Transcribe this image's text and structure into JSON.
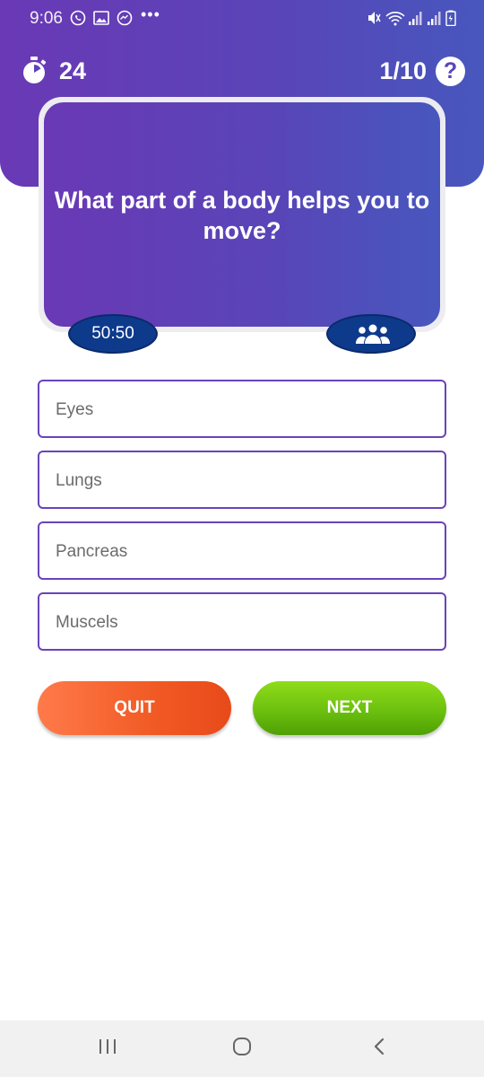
{
  "status_bar": {
    "time": "9:06",
    "icons": [
      "whatsapp-icon",
      "gallery-icon",
      "messenger-icon",
      "more-dots-icon",
      "mute-icon",
      "wifi-icon",
      "signal-icon",
      "signal-icon",
      "battery-icon"
    ],
    "dots": "•••"
  },
  "quiz": {
    "timer": "24",
    "progress": "1/10",
    "help_label": "?",
    "question": "What part of a body helps you to move?",
    "lifelines": {
      "fifty_fifty": "50:50",
      "audience_icon": "group-icon"
    },
    "answers": [
      {
        "label": "Eyes"
      },
      {
        "label": "Lungs"
      },
      {
        "label": "Pancreas"
      },
      {
        "label": "Muscels"
      }
    ],
    "buttons": {
      "quit": "QUIT",
      "next": "NEXT"
    }
  },
  "colors": {
    "header_gradient_start": "#6a39b5",
    "header_gradient_end": "#4757bd",
    "lifeline": "#0e3a8c",
    "answer_border": "#6a43b9",
    "quit": "#f15a24",
    "next": "#6cc00e"
  },
  "nav_bar": {
    "recent_icon": "recent-apps-icon",
    "home_icon": "home-icon",
    "back_icon": "back-icon"
  }
}
